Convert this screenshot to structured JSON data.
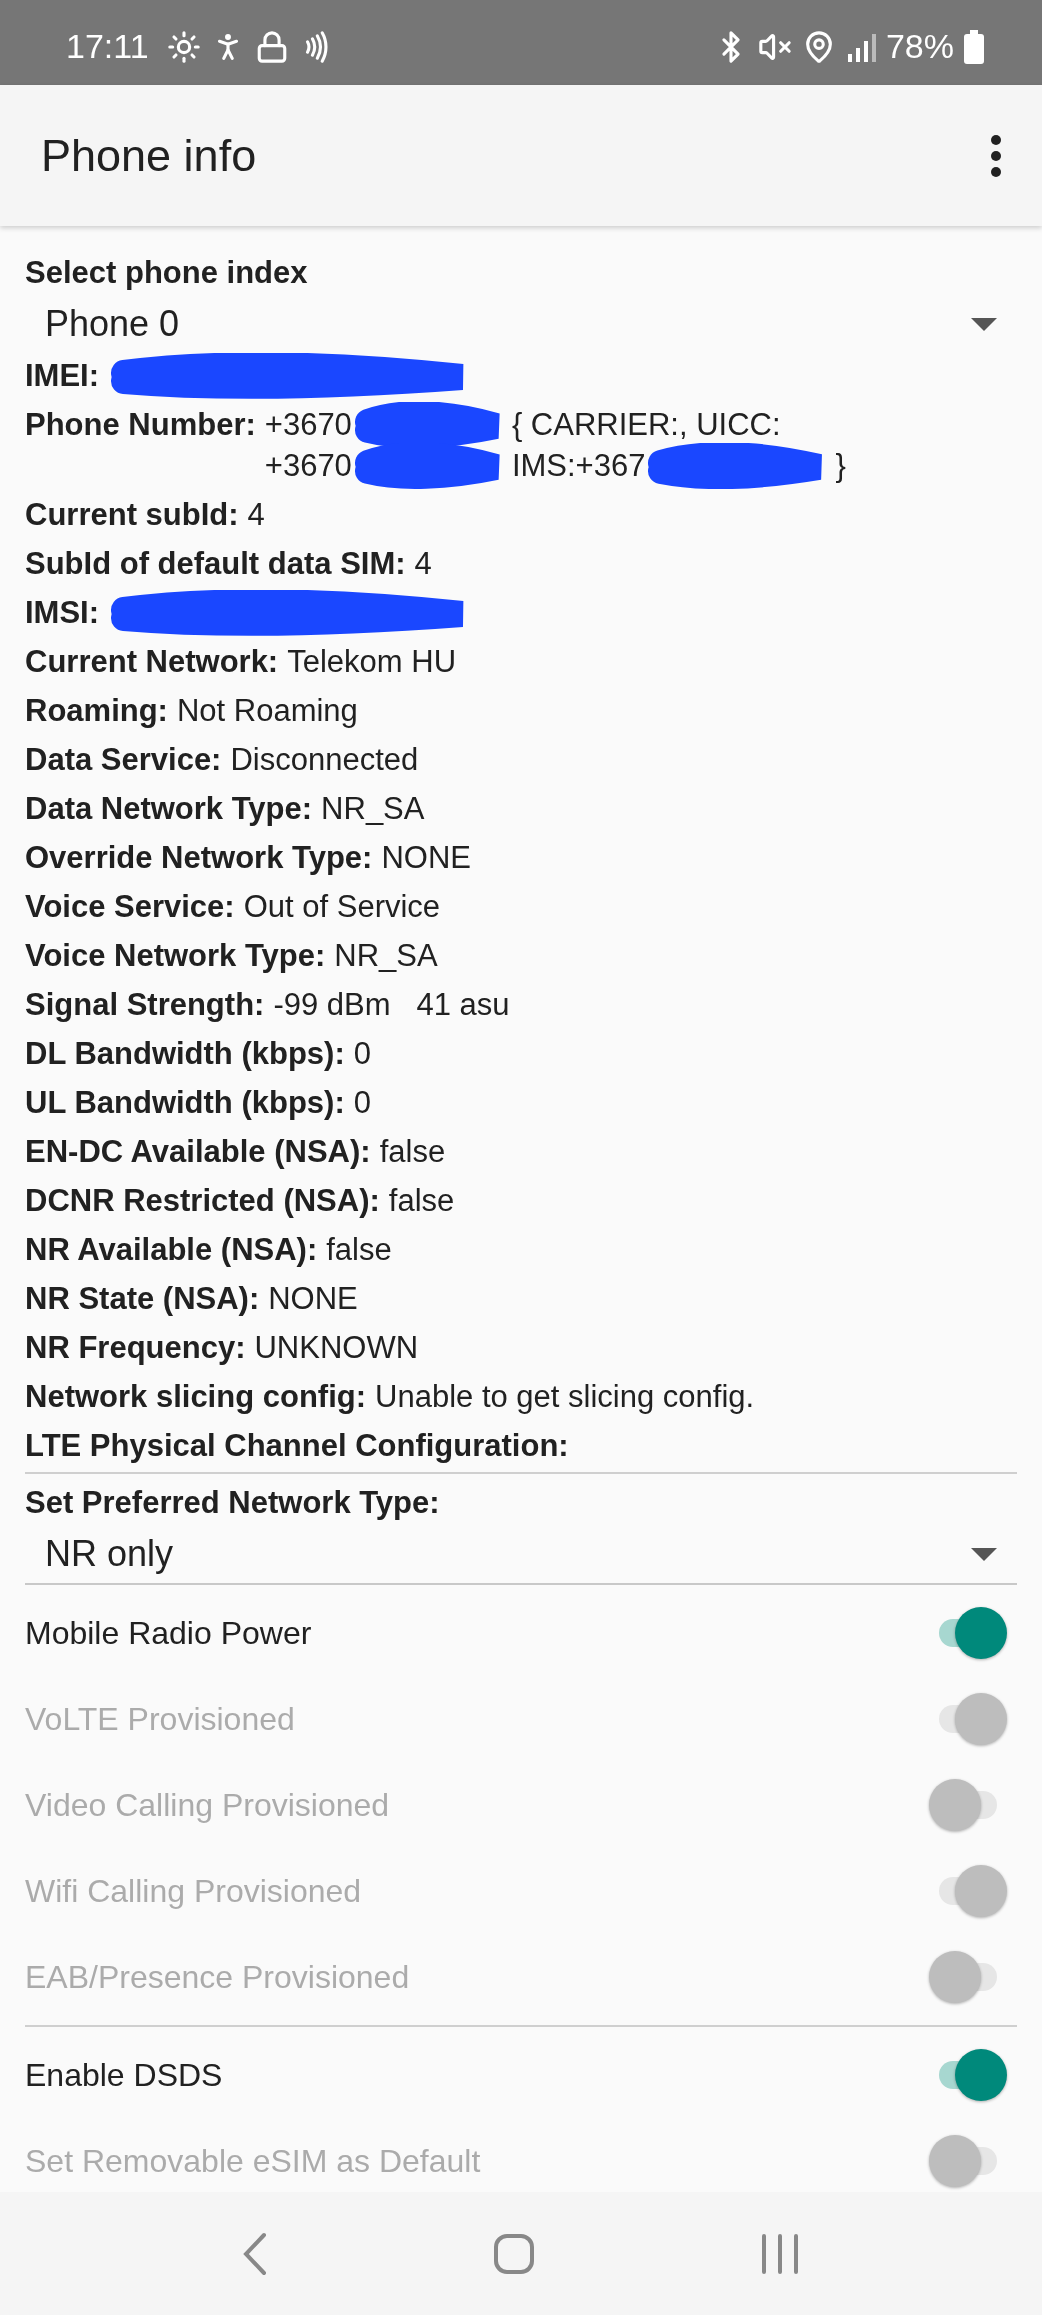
{
  "status_bar": {
    "time": "17:11",
    "battery": "78%"
  },
  "toolbar": {
    "title": "Phone info"
  },
  "phone_index": {
    "label": "Select phone index",
    "value": "Phone 0"
  },
  "info_rows": [
    {
      "label": "IMEI:",
      "lines": [
        [
          {
            "kind": "redaction"
          }
        ]
      ]
    },
    {
      "label": "Phone Number:",
      "lines": [
        [
          {
            "kind": "text",
            "text": "+3670"
          },
          {
            "kind": "redaction"
          },
          {
            "kind": "text",
            "text": "{ CARRIER:, UICC:"
          }
        ],
        [
          {
            "kind": "text",
            "text": "+3670"
          },
          {
            "kind": "redaction"
          },
          {
            "kind": "text",
            "text": "IMS:+367"
          },
          {
            "kind": "redaction"
          },
          {
            "kind": "text",
            "text": "}"
          }
        ]
      ]
    },
    {
      "label": "Current subId:",
      "value": "4"
    },
    {
      "label": "SubId of default data SIM:",
      "value": "4"
    },
    {
      "label": "IMSI:",
      "lines": [
        [
          {
            "kind": "redaction"
          }
        ]
      ]
    },
    {
      "label": "Current Network:",
      "value": "Telekom HU"
    },
    {
      "label": "Roaming:",
      "value": "Not Roaming"
    },
    {
      "label": "Data Service:",
      "value": "Disconnected"
    },
    {
      "label": "Data Network Type:",
      "value": "NR_SA"
    },
    {
      "label": "Override Network Type:",
      "value": "NONE"
    },
    {
      "label": "Voice Service:",
      "value": "Out of Service"
    },
    {
      "label": "Voice Network Type:",
      "value": "NR_SA"
    },
    {
      "label": "Signal Strength:",
      "value": "-99 dBm   41 asu"
    },
    {
      "label": "DL Bandwidth (kbps):",
      "value": "0"
    },
    {
      "label": "UL Bandwidth (kbps):",
      "value": "0"
    },
    {
      "label": "EN-DC Available (NSA):",
      "value": "false"
    },
    {
      "label": "DCNR Restricted (NSA):",
      "value": "false"
    },
    {
      "label": "NR Available (NSA):",
      "value": "false"
    },
    {
      "label": "NR State (NSA):",
      "value": "NONE"
    },
    {
      "label": "NR Frequency:",
      "value": "UNKNOWN"
    },
    {
      "label": "Network slicing config:",
      "value": "Unable to get slicing config."
    },
    {
      "label": "LTE Physical Channel Configuration:"
    }
  ],
  "preferred_network": {
    "label": "Set Preferred Network Type:",
    "value": "NR only"
  },
  "toggle_groups": [
    [
      {
        "label": "Mobile Radio Power",
        "on": true,
        "disabled": false
      },
      {
        "label": "VoLTE Provisioned",
        "on": true,
        "disabled": true
      },
      {
        "label": "Video Calling Provisioned",
        "on": false,
        "disabled": true
      },
      {
        "label": "Wifi Calling Provisioned",
        "on": true,
        "disabled": true
      },
      {
        "label": "EAB/Presence Provisioned",
        "on": false,
        "disabled": true
      }
    ],
    [
      {
        "label": "Enable DSDS",
        "on": true,
        "disabled": false
      },
      {
        "label": "Set Removable eSIM as Default",
        "on": false,
        "disabled": true
      }
    ]
  ]
}
